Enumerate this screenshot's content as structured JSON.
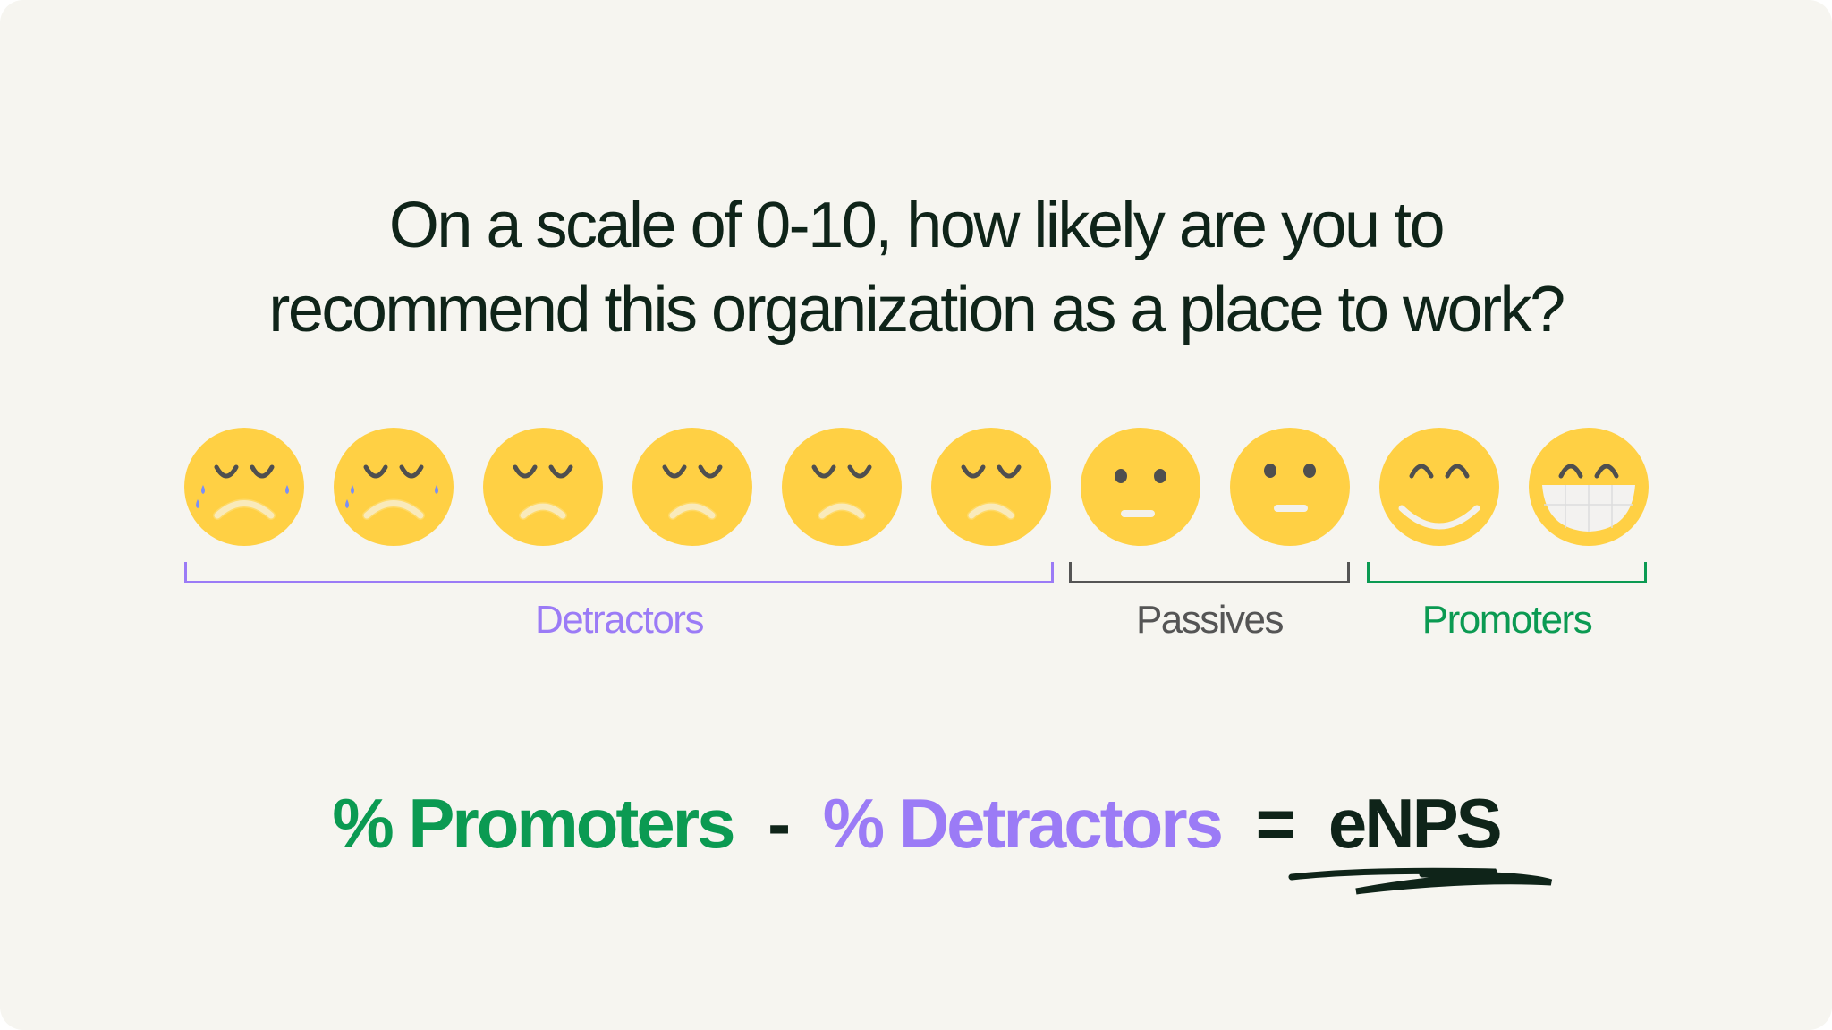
{
  "question": {
    "line1": "On a scale of 0-10, how likely are you to",
    "line2": "recommend this organization as a place to work?"
  },
  "faces": [
    "crying",
    "crying",
    "sad",
    "sad",
    "sad",
    "sad",
    "neutral",
    "neutral",
    "smiling",
    "grinning"
  ],
  "groups": [
    {
      "label": "Detractors",
      "color": "#9b7bf6"
    },
    {
      "label": "Passives",
      "color": "#555555"
    },
    {
      "label": "Promoters",
      "color": "#0b9a52"
    }
  ],
  "formula": {
    "promoters": "% Promoters",
    "minus": "-",
    "detractors": "% Detractors",
    "equals": "=",
    "result": "eNPS"
  },
  "colors": {
    "background": "#f6f5f0",
    "text": "#0f2419",
    "face": "#ffd044",
    "features": "#4f4f4f",
    "tear": "#7b8ff6"
  }
}
